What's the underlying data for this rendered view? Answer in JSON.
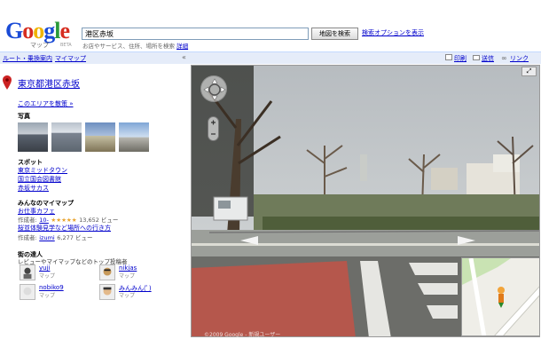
{
  "header": {
    "logo_word": "Google",
    "logo_sub": "マップ",
    "logo_beta": "BETA",
    "search_value": "港区赤坂",
    "search_button": "地図を検索",
    "advanced_link": "検索オプションを表示",
    "hint": "お店やサービス、住所、場所を検索",
    "hint_link": "詳細"
  },
  "topbar": {
    "route_link": "ルート・乗換案内",
    "mymap_link": "マイマップ",
    "print": "印刷",
    "send": "送信",
    "link": "リンク"
  },
  "sidebar": {
    "place_title": "東京都港区赤坂",
    "explore_link": "このエリアを散策 »",
    "photos_heading": "写真",
    "spots_heading": "スポット",
    "spots": [
      "東京ミッドタウン",
      "国立国会図書館",
      "赤坂サカス"
    ],
    "mymaps_heading": "みんなのマイマップ",
    "mymaps": [
      {
        "title": "お仕事カフェ",
        "author_label": "作成者:",
        "author": "10-",
        "rating": "★★★★★",
        "views": "13,652 ビュー"
      },
      {
        "title": "桜並体験見学など場所への行き方",
        "author_label": "作成者:",
        "author": "izumi",
        "views": "6,277 ビュー"
      }
    ],
    "masters_heading": "街の達人",
    "masters_sub": "レビューやマイマップなどのトップ投稿者",
    "masters": [
      {
        "name": "yuji",
        "role": "マップ"
      },
      {
        "name": "nikjas",
        "role": "マップ"
      },
      {
        "name": "nobiko9",
        "role": "マップ"
      },
      {
        "name": "みんみん(ﾟ)",
        "role": "マップ"
      }
    ]
  },
  "map": {
    "copyright": "©2009 Google - 新規ユーザー"
  },
  "colors": {
    "link": "#0000cc",
    "topbar": "#e5ecf9",
    "pin": "#cc0000"
  }
}
